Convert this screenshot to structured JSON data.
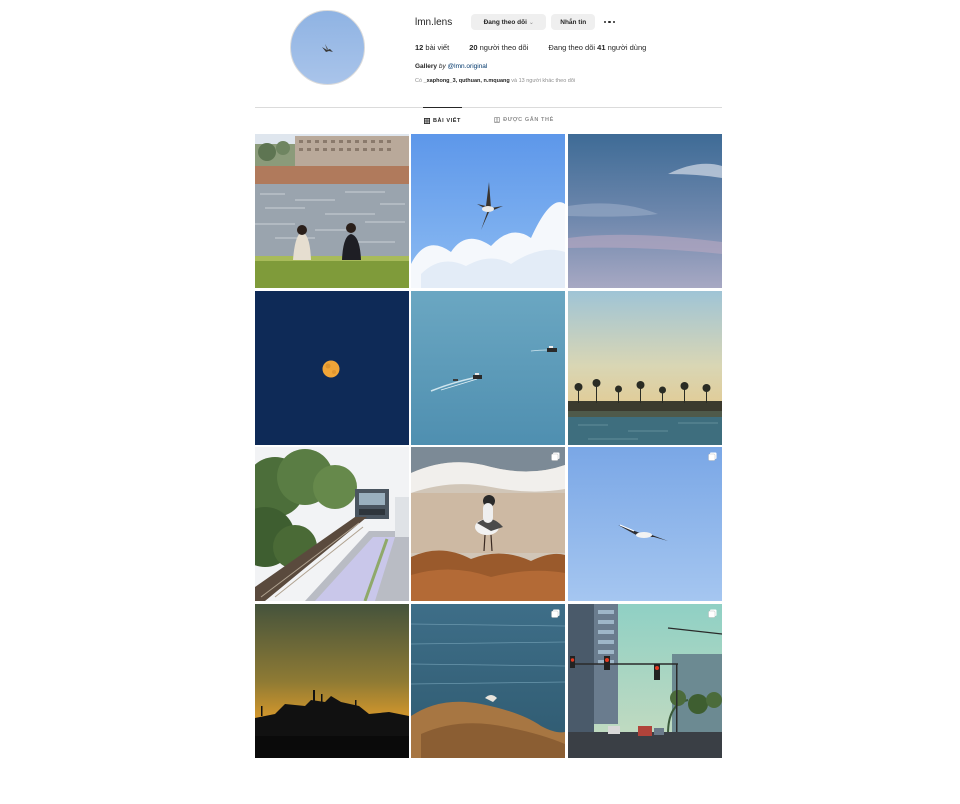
{
  "profile": {
    "username": "lmn.lens",
    "follow_button": "Đang theo dõi",
    "message_button": "Nhắn tin",
    "more_icon": "more-horizontal-icon",
    "avatar_icon": "seagull-avatar"
  },
  "stats": {
    "posts_count": "12",
    "posts_label": " bài viết",
    "followers_count": "20",
    "followers_label": " người theo dõi",
    "following_prefix": "Đang theo dõi ",
    "following_count": "41",
    "following_label": " người dùng"
  },
  "bio": {
    "name": "Gallery",
    "by": " by ",
    "link": "@lmn.original"
  },
  "followed_by": {
    "prefix": "Có ",
    "names": "_xaphong_3, quthuan, n.mquang",
    "suffix": " và 13 người khác theo dõi"
  },
  "tabs": [
    {
      "label": "BÀI VIẾT",
      "icon": "grid-icon",
      "active": true
    },
    {
      "label": "ĐƯỢC GẮN THẺ",
      "icon": "tagged-icon",
      "active": false
    }
  ],
  "posts": [
    {
      "subject": "couple-by-lake",
      "multiple": false
    },
    {
      "subject": "seagull-clouds",
      "multiple": false
    },
    {
      "subject": "evening-sky",
      "multiple": false
    },
    {
      "subject": "full-moon",
      "multiple": false
    },
    {
      "subject": "boats-sea",
      "multiple": false
    },
    {
      "subject": "palm-shoreline",
      "multiple": false
    },
    {
      "subject": "train-station",
      "multiple": false
    },
    {
      "subject": "gull-on-beach",
      "multiple": true
    },
    {
      "subject": "gull-flying-sky",
      "multiple": true
    },
    {
      "subject": "sunset-silhouette",
      "multiple": false
    },
    {
      "subject": "bird-on-rock",
      "multiple": true
    },
    {
      "subject": "city-street-traffic-lights",
      "multiple": true
    }
  ],
  "colors": {
    "text": "#262626",
    "muted": "#8e8e8e",
    "button_bg": "#efefef",
    "link": "#00376b",
    "divider": "#dbdbdb"
  }
}
